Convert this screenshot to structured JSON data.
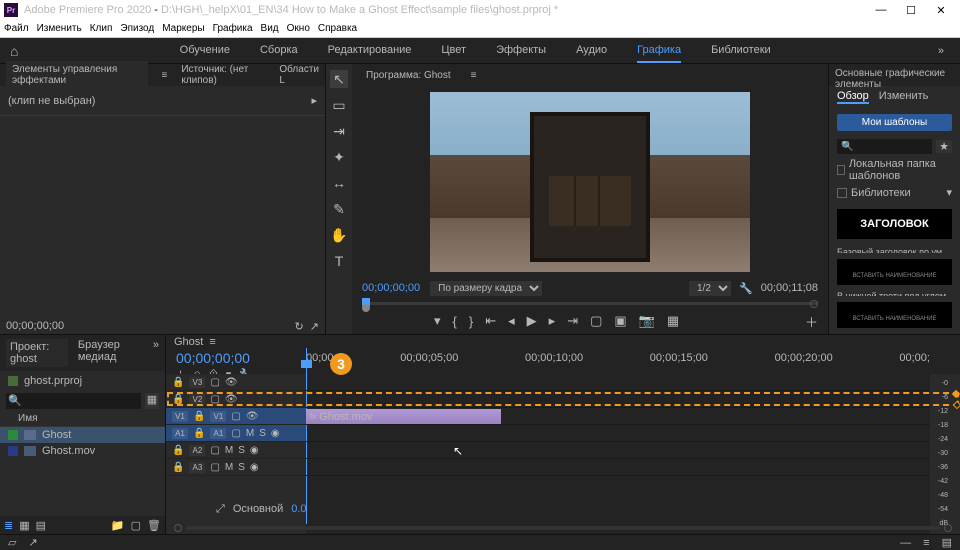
{
  "titlebar": {
    "app": "Adobe Premiere Pro 2020",
    "path": "D:\\HGH\\_helpX\\01_EN\\34 How to Make a Ghost Effect\\sample files\\ghost.prproj *"
  },
  "menubar": [
    "Файл",
    "Изменить",
    "Клип",
    "Эпизод",
    "Маркеры",
    "Графика",
    "Вид",
    "Окно",
    "Справка"
  ],
  "workspaces": {
    "items": [
      "Обучение",
      "Сборка",
      "Редактирование",
      "Цвет",
      "Эффекты",
      "Аудио",
      "Графика",
      "Библиотеки"
    ],
    "active": 6
  },
  "leftpanel": {
    "tabs": [
      "Элементы управления эффектами",
      "Источник: (нет клипов)",
      "Области L"
    ],
    "nosel": "(клип не выбран)",
    "tc": "00;00;00;00"
  },
  "program": {
    "tab": "Программа: Ghost",
    "tc": "00;00;00;00",
    "fit": "По размеру кадра",
    "ratio": "1/2",
    "dur": "00;00;11;08"
  },
  "essentialGraphics": {
    "title": "Основные графические элементы",
    "tabs": [
      "Обзор",
      "Изменить"
    ],
    "btn": "Мои шаблоны",
    "check1": "Локальная папка шаблонов",
    "check2": "Библиотеки",
    "thumb1": "ЗАГОЛОВОК",
    "label1": "Базовый заголовок по умолч...",
    "subtext": "ВСТАВИТЬ НАИМЕНОВАНИЕ",
    "label2": "В нижней трети под углом"
  },
  "project": {
    "tabs": [
      "Проект: ghost",
      "Браузер медиад"
    ],
    "file": "ghost.prproj",
    "col": "Имя",
    "items": [
      {
        "name": "Ghost",
        "type": "seq"
      },
      {
        "name": "Ghost.mov",
        "type": "mov"
      }
    ]
  },
  "timeline": {
    "tab": "Ghost",
    "tc": "00;00;00;00",
    "ruler": [
      "00;00",
      "00;00;05;00",
      "00;00;10;00",
      "00;00;15;00",
      "00;00;20;00",
      "00;00;"
    ],
    "tracks": {
      "video": [
        "V3",
        "V2",
        "V1"
      ],
      "audio": [
        "A1",
        "A2",
        "A3"
      ]
    },
    "clip": "Ghost.mov",
    "info_label": "Основной",
    "info_val": "0.0",
    "annotation": "3"
  },
  "search_placeholder": "🔍"
}
